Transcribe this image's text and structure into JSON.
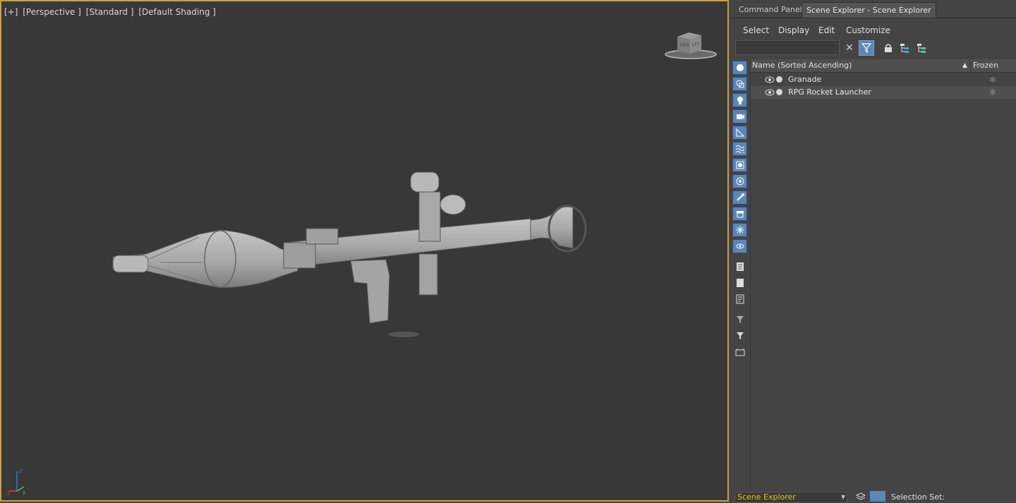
{
  "viewport": {
    "labels": [
      "[+]",
      "[Perspective ]",
      "[Standard ]",
      "[Default Shading ]"
    ],
    "viewcube": {
      "front": "FRO",
      "left": "LFT"
    },
    "axis": {
      "z": "z",
      "x": "x",
      "y": "y"
    }
  },
  "panel": {
    "tabs": [
      "Command Panel",
      "Scene Explorer - Scene Explorer"
    ],
    "menu": [
      "Select",
      "Display",
      "Edit",
      "Customize"
    ],
    "search": {
      "value": "",
      "placeholder": ""
    },
    "columns": {
      "name": "Name (Sorted Ascending)",
      "sort_indicator": "▲",
      "frozen": "Frozen"
    },
    "rows": [
      {
        "name": "Granade"
      },
      {
        "name": "RPG Rocket Launcher"
      }
    ],
    "bottom": {
      "explorer_select": "Scene Explorer",
      "selection_set": "Selection Set:"
    }
  },
  "colors": {
    "viewport_border": "#c8a13a",
    "accent": "#5b87b8",
    "dropdown_text": "#e7c400"
  }
}
